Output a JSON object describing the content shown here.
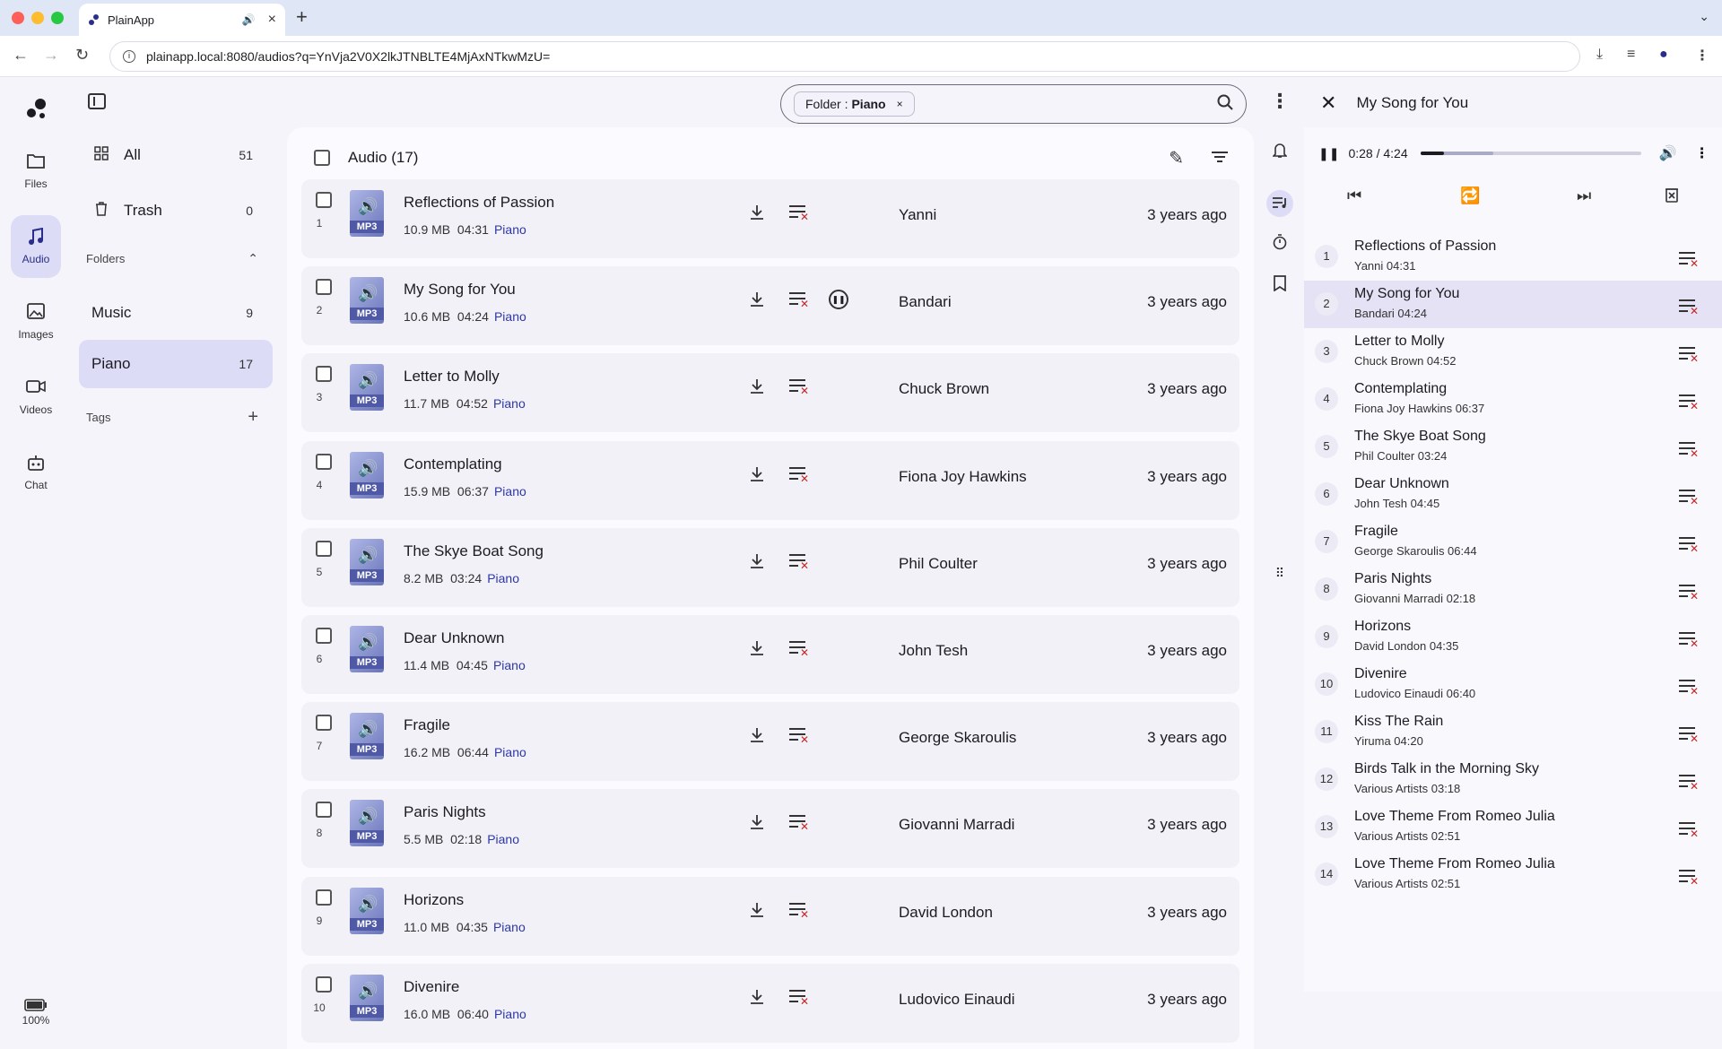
{
  "browser": {
    "tab_title": "PlainApp",
    "tab_close": "×",
    "new_tab": "+",
    "url": "plainapp.local:8080/audios?q=YnVja2V0X2lkJTNBLTE4MjAxNTkwMzU="
  },
  "rail": {
    "items": [
      {
        "label": "Files",
        "icon": "folder-icon"
      },
      {
        "label": "Audio",
        "icon": "music-note-icon"
      },
      {
        "label": "Images",
        "icon": "image-icon"
      },
      {
        "label": "Videos",
        "icon": "video-icon"
      },
      {
        "label": "Chat",
        "icon": "robot-icon"
      }
    ],
    "battery": "100%"
  },
  "sidebar": {
    "all_label": "All",
    "all_count": "51",
    "trash_label": "Trash",
    "trash_count": "0",
    "folders_heading": "Folders",
    "folders": [
      {
        "label": "Music",
        "count": "9"
      },
      {
        "label": "Piano",
        "count": "17"
      }
    ],
    "tags_heading": "Tags"
  },
  "search": {
    "chip_key": "Folder :",
    "chip_value": "Piano",
    "chip_close": "×"
  },
  "list": {
    "title": "Audio (17)",
    "rows": [
      {
        "num": "1",
        "title": "Reflections of Passion",
        "size": "10.9 MB",
        "duration": "04:31",
        "folder": "Piano",
        "artist": "Yanni",
        "time": "3 years ago"
      },
      {
        "num": "2",
        "title": "My Song for You",
        "size": "10.6 MB",
        "duration": "04:24",
        "folder": "Piano",
        "artist": "Bandari",
        "time": "3 years ago"
      },
      {
        "num": "3",
        "title": "Letter to Molly",
        "size": "11.7 MB",
        "duration": "04:52",
        "folder": "Piano",
        "artist": "Chuck Brown",
        "time": "3 years ago"
      },
      {
        "num": "4",
        "title": "Contemplating",
        "size": "15.9 MB",
        "duration": "06:37",
        "folder": "Piano",
        "artist": "Fiona Joy Hawkins",
        "time": "3 years ago"
      },
      {
        "num": "5",
        "title": "The Skye Boat Song",
        "size": "8.2 MB",
        "duration": "03:24",
        "folder": "Piano",
        "artist": "Phil Coulter",
        "time": "3 years ago"
      },
      {
        "num": "6",
        "title": "Dear Unknown",
        "size": "11.4 MB",
        "duration": "04:45",
        "folder": "Piano",
        "artist": "John Tesh",
        "time": "3 years ago"
      },
      {
        "num": "7",
        "title": "Fragile",
        "size": "16.2 MB",
        "duration": "06:44",
        "folder": "Piano",
        "artist": "George Skaroulis",
        "time": "3 years ago"
      },
      {
        "num": "8",
        "title": "Paris Nights",
        "size": "5.5 MB",
        "duration": "02:18",
        "folder": "Piano",
        "artist": "Giovanni Marradi",
        "time": "3 years ago"
      },
      {
        "num": "9",
        "title": "Horizons",
        "size": "11.0 MB",
        "duration": "04:35",
        "folder": "Piano",
        "artist": "David London",
        "time": "3 years ago"
      },
      {
        "num": "10",
        "title": "Divenire",
        "size": "16.0 MB",
        "duration": "06:40",
        "folder": "Piano",
        "artist": "Ludovico Einaudi",
        "time": "3 years ago"
      }
    ],
    "mp3_label": "MP3"
  },
  "player": {
    "title": "My Song for You",
    "time": "0:28 / 4:24",
    "progress_fraction": 0.106,
    "buffered_fraction": 0.33,
    "queue": [
      {
        "num": "1",
        "title": "Reflections of Passion",
        "sub": "Yanni 04:31"
      },
      {
        "num": "2",
        "title": "My Song for You",
        "sub": "Bandari 04:24"
      },
      {
        "num": "3",
        "title": "Letter to Molly",
        "sub": "Chuck Brown 04:52"
      },
      {
        "num": "4",
        "title": "Contemplating",
        "sub": "Fiona Joy Hawkins 06:37"
      },
      {
        "num": "5",
        "title": "The Skye Boat Song",
        "sub": "Phil Coulter 03:24"
      },
      {
        "num": "6",
        "title": "Dear Unknown",
        "sub": "John Tesh 04:45"
      },
      {
        "num": "7",
        "title": "Fragile",
        "sub": "George Skaroulis 06:44"
      },
      {
        "num": "8",
        "title": "Paris Nights",
        "sub": "Giovanni Marradi 02:18"
      },
      {
        "num": "9",
        "title": "Horizons",
        "sub": "David London 04:35"
      },
      {
        "num": "10",
        "title": "Divenire",
        "sub": "Ludovico Einaudi 06:40"
      },
      {
        "num": "11",
        "title": "Kiss The Rain",
        "sub": "Yiruma 04:20"
      },
      {
        "num": "12",
        "title": "Birds Talk in the Morning Sky",
        "sub": "Various Artists 03:18"
      },
      {
        "num": "13",
        "title": "Love Theme From Romeo Julia",
        "sub": "Various Artists 02:51"
      },
      {
        "num": "14",
        "title": "Love Theme From Romeo Julia",
        "sub": "Various Artists 02:51"
      }
    ]
  },
  "colors": {
    "accent": "#2d37a8",
    "active_bg": "#dcdcf6",
    "remove_red": "#c62828"
  }
}
